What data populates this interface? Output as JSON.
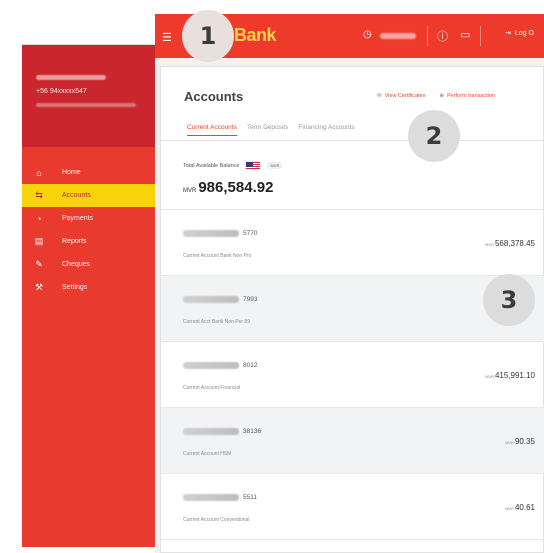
{
  "topbar": {
    "brand": "Bank",
    "logout_label": "Log O",
    "icons": {
      "menu": "hamburger-icon",
      "clock": "clock-icon",
      "info": "info-icon",
      "book": "book-icon",
      "logout": "logout-icon"
    }
  },
  "sidebar": {
    "phone": "+56 94xxxxx547",
    "items": [
      {
        "icon": "home-icon",
        "glyph": "⌂",
        "label": "Home"
      },
      {
        "icon": "accounts-icon",
        "glyph": "⇆",
        "label": "Accounts"
      },
      {
        "icon": "payments-icon",
        "glyph": "◔",
        "label": "Payments"
      },
      {
        "icon": "reports-icon",
        "glyph": "▤",
        "label": "Reports"
      },
      {
        "icon": "cheques-icon",
        "glyph": "✎",
        "label": "Cheques"
      },
      {
        "icon": "settings-icon",
        "glyph": "⚒",
        "label": "Settings"
      }
    ]
  },
  "main": {
    "title": "Accounts",
    "links": {
      "view_certificates": "View Certificates",
      "perform_transaction": "Perform transaction"
    },
    "tabs": [
      "Current Accounts",
      "Term Deposits",
      "Financing Accounts"
    ],
    "balance_label": "Total Available Balance",
    "balance_currency_pill": "MVR",
    "balance_currency": "MVR",
    "balance_amount": "986,584.92",
    "accounts": [
      {
        "suffix": "5770",
        "type": "Current Account Bank Non Pro",
        "currency": "MVR",
        "amount": "568,378.45"
      },
      {
        "suffix": "7993",
        "type": "Current Acct Bank Non Per 89",
        "currency": "MVR",
        "amount": ""
      },
      {
        "suffix": "8012",
        "type": "Current Account Financial",
        "currency": "MVR",
        "amount": "415,991.10"
      },
      {
        "suffix": "38136",
        "type": "Current Account HSM",
        "currency": "MVR",
        "amount": "90.35"
      },
      {
        "suffix": "5511",
        "type": "Current Account Conventional",
        "currency": "MVR",
        "amount": "40.61"
      }
    ]
  },
  "callouts": [
    "1",
    "2",
    "3"
  ],
  "colors": {
    "brand_red": "#ee3a2a",
    "sidebar_red": "#e83a2e",
    "active_yellow": "#f7d40a",
    "accent": "#e0492f"
  }
}
